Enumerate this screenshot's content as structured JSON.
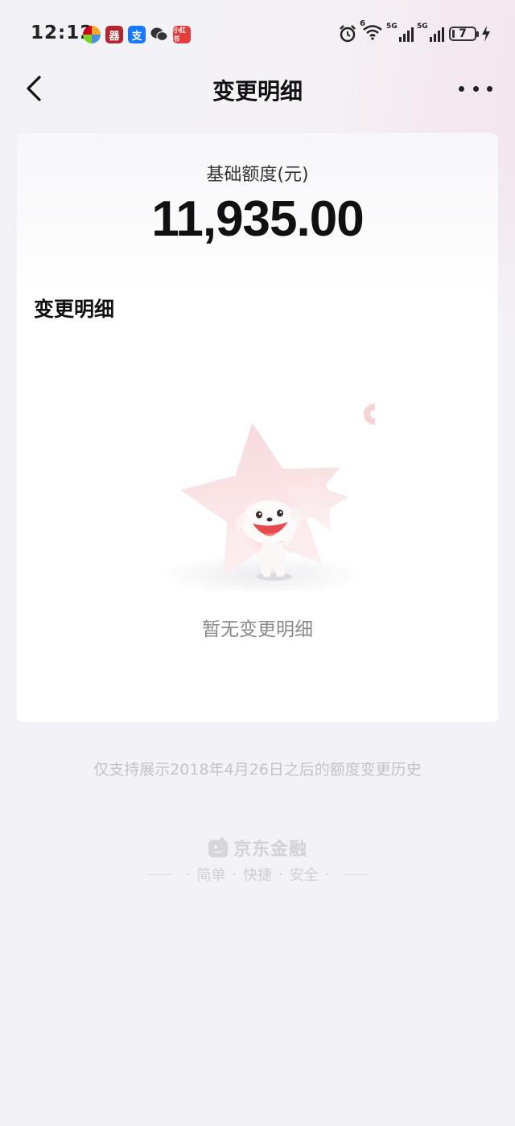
{
  "status_bar": {
    "time": "12:12",
    "battery": "7",
    "app_icons": [
      "multicolor-app-icon",
      "bank-app-icon",
      "alipay-icon",
      "wechat-icon",
      "xiaohongshu-icon"
    ],
    "app_icon_labels": [
      "",
      "器",
      "支",
      "",
      "小红书"
    ],
    "network_labels": [
      "5G",
      "5G"
    ],
    "wifi_label": "6"
  },
  "header": {
    "title": "变更明细"
  },
  "card": {
    "quota_label": "基础额度(元)",
    "quota_value": "11,935.00",
    "section_title": "变更明细",
    "empty_text": "暂无变更明细"
  },
  "footer": {
    "note": "仅支持展示2018年4月26日之后的额度变更历史",
    "brand_name": "京东金融",
    "slogan": [
      "简单",
      "快捷",
      "安全"
    ]
  },
  "colors": {
    "background": "#f3f2f7",
    "card": "#ffffff",
    "accent_pink": "#f6d3d6",
    "mascot_red": "#e84b4b"
  }
}
